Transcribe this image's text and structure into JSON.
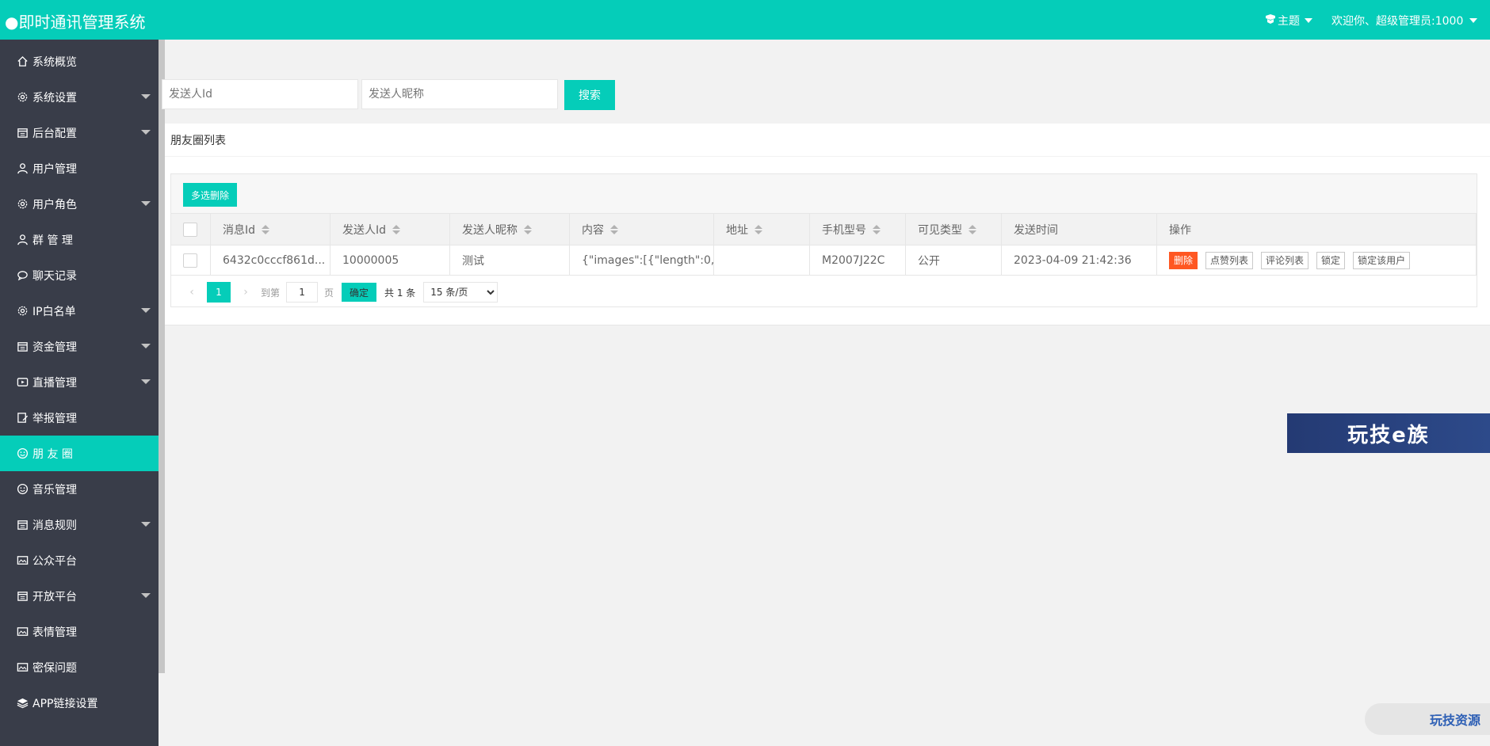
{
  "header": {
    "title": "●即时通讯管理系统",
    "theme_label": "主题",
    "user_label": "欢迎你、超级管理员:1000"
  },
  "sidebar": {
    "items": [
      {
        "label": "系统概览",
        "icon": "home-icon",
        "has_sub": false,
        "active": false
      },
      {
        "label": "系统设置",
        "icon": "gear-icon",
        "has_sub": true,
        "active": false
      },
      {
        "label": "后台配置",
        "icon": "calendar-icon",
        "has_sub": true,
        "active": false
      },
      {
        "label": "用户管理",
        "icon": "user-icon",
        "has_sub": false,
        "active": false
      },
      {
        "label": "用户角色",
        "icon": "gear-icon",
        "has_sub": true,
        "active": false
      },
      {
        "label": "群 管 理",
        "icon": "user-icon",
        "has_sub": false,
        "active": false
      },
      {
        "label": "聊天记录",
        "icon": "chat-icon",
        "has_sub": false,
        "active": false
      },
      {
        "label": "IP白名单",
        "icon": "gear-icon",
        "has_sub": true,
        "active": false
      },
      {
        "label": "资金管理",
        "icon": "calendar-icon",
        "has_sub": true,
        "active": false
      },
      {
        "label": "直播管理",
        "icon": "video-icon",
        "has_sub": true,
        "active": false
      },
      {
        "label": "举报管理",
        "icon": "edit-icon",
        "has_sub": false,
        "active": false
      },
      {
        "label": "朋 友 圈",
        "icon": "smile-icon",
        "has_sub": false,
        "active": true
      },
      {
        "label": "音乐管理",
        "icon": "smile-icon",
        "has_sub": false,
        "active": false
      },
      {
        "label": "消息规则",
        "icon": "calendar-icon",
        "has_sub": true,
        "active": false
      },
      {
        "label": "公众平台",
        "icon": "image-icon",
        "has_sub": false,
        "active": false
      },
      {
        "label": "开放平台",
        "icon": "calendar-icon",
        "has_sub": true,
        "active": false
      },
      {
        "label": "表情管理",
        "icon": "image-icon",
        "has_sub": false,
        "active": false
      },
      {
        "label": "密保问题",
        "icon": "image-icon",
        "has_sub": false,
        "active": false
      },
      {
        "label": "APP链接设置",
        "icon": "layers-icon",
        "has_sub": false,
        "active": false
      }
    ]
  },
  "search": {
    "sender_id_placeholder": "发送人Id",
    "sender_nick_placeholder": "发送人昵称",
    "button_label": "搜索"
  },
  "card": {
    "title": "朋友圈列表",
    "multi_delete_label": "多选删除"
  },
  "table": {
    "headers": [
      "消息Id",
      "发送人Id",
      "发送人昵称",
      "内容",
      "地址",
      "手机型号",
      "可见类型",
      "发送时间",
      "操作"
    ],
    "rows": [
      {
        "msg_id": "6432c0cccf861d...",
        "sender_id": "10000005",
        "sender_nick": "测试",
        "content": "{\"images\":[{\"length\":0,...",
        "address": "",
        "phone_model": "M2007J22C",
        "visibility": "公开",
        "send_time": "2023-04-09 21:42:36",
        "actions": [
          "删除",
          "点赞列表",
          "评论列表",
          "锁定",
          "锁定该用户"
        ]
      }
    ]
  },
  "pager": {
    "current_page": "1",
    "goto_label": "到第",
    "goto_value": "1",
    "page_unit": "页",
    "confirm_label": "确定",
    "total_label": "共 1 条",
    "page_size_option": "15 条/页"
  },
  "watermarks": {
    "banner_text": "玩技e族",
    "corner_text": "玩技资源"
  },
  "colors": {
    "brand": "#05cdb9",
    "sidebar_bg": "#393d49",
    "danger": "#ff5722"
  }
}
